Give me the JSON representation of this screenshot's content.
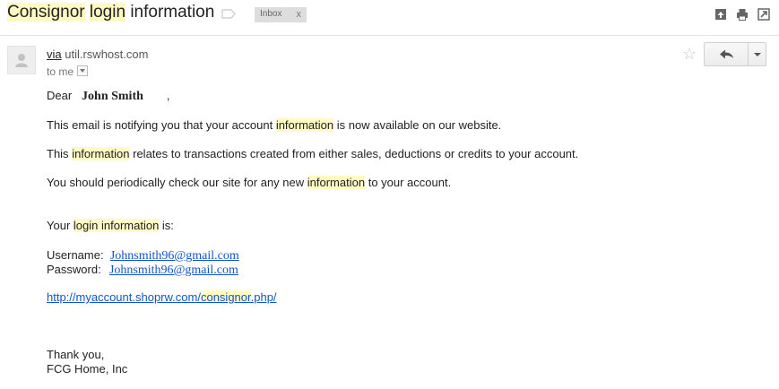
{
  "subject": {
    "part1": "Consignor",
    "part2": "login",
    "part3": "information"
  },
  "labels": {
    "inbox": "Inbox",
    "remove": "x"
  },
  "icons": {
    "label": "label-tag-icon",
    "open_new": "open-in-new-window-icon",
    "print": "print-icon",
    "popout": "popout-icon",
    "avatar": "avatar-icon",
    "star": "star-icon",
    "reply": "reply-icon",
    "more": "chevron-down-icon"
  },
  "sender": {
    "via_label": "via",
    "domain": "util.rswhost.com",
    "to": "to me"
  },
  "star_glyph": "☆",
  "body": {
    "greeting": "Dear",
    "name": "John Smith",
    "greeting_comma": ",",
    "p1_a": "This email is notifying you that your account",
    "p1_hl": "information",
    "p1_b": "is now available on our website.",
    "p2_a": "This",
    "p2_hl": "information",
    "p2_b": "relates to transactions created from either sales, deductions or credits to your account.",
    "p3_a": "You should periodically check our site for any new",
    "p3_hl": "information",
    "p3_b": "to your account.",
    "login_a": "Your",
    "login_hl": "login information",
    "login_b": "is:",
    "username_label": "Username:",
    "username_value": "Johnsmith96@gmail.com",
    "password_label": "Password:",
    "password_value": "Johnsmith96@gmail.com",
    "url_a": "http://myaccount.shoprw.com/",
    "url_hl": "consignor",
    "url_b": ".php/",
    "thanks": "Thank you,",
    "signature": "FCG Home, Inc"
  },
  "colors": {
    "highlight": "#fff9c4",
    "link": "#1155cc"
  }
}
